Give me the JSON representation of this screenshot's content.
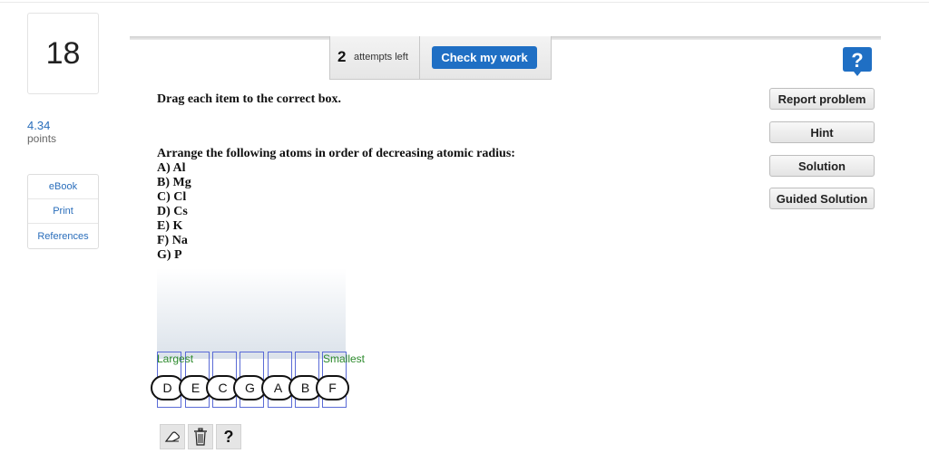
{
  "question": {
    "number": "18",
    "points_value": "4.34",
    "points_label": "points"
  },
  "sidebar_links": [
    "eBook",
    "Print",
    "References"
  ],
  "header": {
    "attempts_number": "2",
    "attempts_text": "attempts left",
    "check_button": "Check my work"
  },
  "help": {
    "icon": "question-mark-icon",
    "color": "#1f6fc4"
  },
  "side_buttons": [
    "Report problem",
    "Hint",
    "Solution",
    "Guided Solution"
  ],
  "instruction": "Drag each item to the correct box.",
  "prompt": {
    "question": "Arrange the following atoms in order of decreasing atomic radius:",
    "options": [
      "A) Al",
      "B) Mg",
      "C) Cl",
      "D) Cs",
      "E) K",
      "F) Na",
      "G) P"
    ]
  },
  "drag_area": {
    "label_start": "Largest",
    "label_end": "Smallest",
    "tokens": [
      "D",
      "E",
      "C",
      "G",
      "A",
      "B",
      "F"
    ]
  },
  "tools": {
    "eraser": "eraser-icon",
    "trash": "trash-icon",
    "help_text": "?"
  },
  "colors": {
    "accent": "#1f6fc4",
    "link": "#2a6ebb",
    "slot_border": "#5a6bd6",
    "slot_label": "#2c8a2c"
  }
}
